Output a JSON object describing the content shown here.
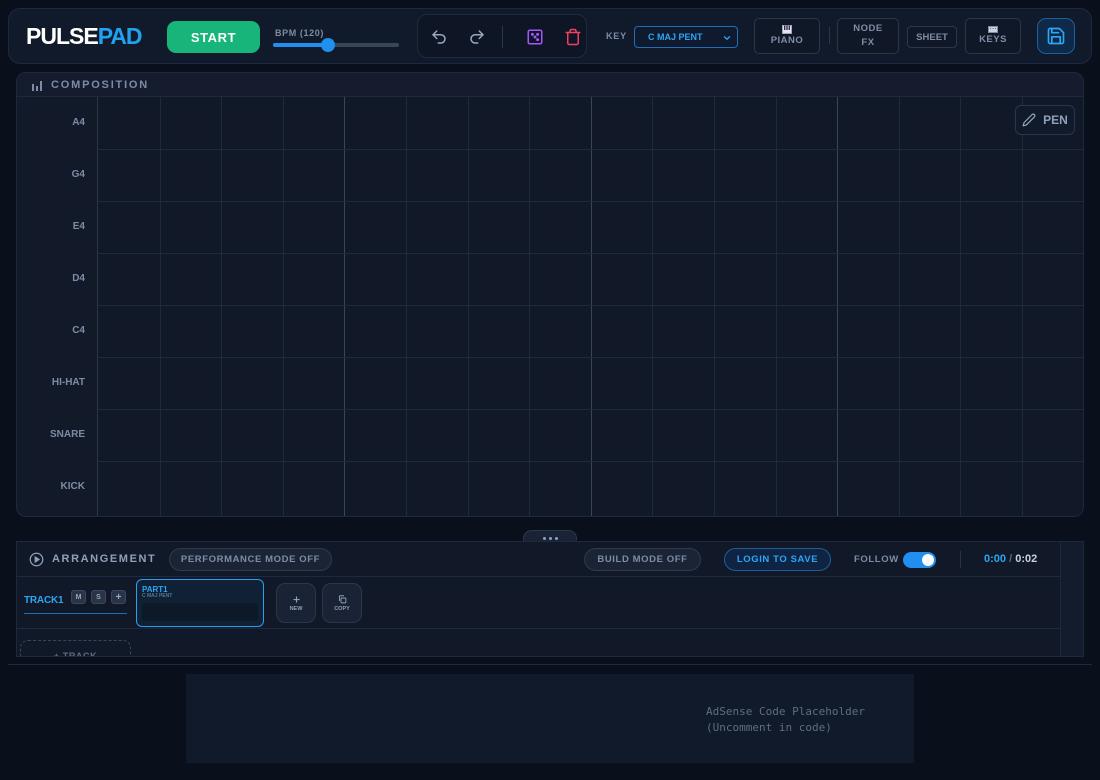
{
  "header": {
    "logo_part1": "PULSE",
    "logo_part2": "PAD",
    "start_label": "START",
    "bpm_label": "BPM (120)",
    "bpm_fraction": 0.44,
    "key_label": "KEY",
    "key_value": "C MAJ PENT",
    "piano_label": "PIANO",
    "node_label_1": "NODE",
    "node_label_2": "FX",
    "sheet_label": "SHEET",
    "keys_label": "KEYS",
    "icons": {
      "undo": "undo-icon",
      "redo": "redo-icon",
      "randomize": "dice-icon",
      "delete": "trash-icon",
      "save": "save-icon"
    },
    "colors": {
      "start": "#17b57a",
      "accent": "#1f8ff0",
      "dice": "#a855f7",
      "trash": "#f43f5e"
    }
  },
  "composition": {
    "title": "COMPOSITION",
    "pen_label": "PEN",
    "rows": [
      "A4",
      "G4",
      "E4",
      "D4",
      "C4",
      "HI-HAT",
      "SNARE",
      "KICK"
    ],
    "columns": 16,
    "bar_every": 4
  },
  "arrangement": {
    "title": "ARRANGEMENT",
    "performance_mode": "PERFORMANCE MODE OFF",
    "build_mode": "BUILD MODE OFF",
    "login_to_save": "LOGIN TO SAVE",
    "follow_label": "FOLLOW",
    "follow_on": true,
    "time_current": "0:00",
    "time_separator": "/",
    "time_total": "0:02",
    "track": {
      "name": "TRACK1",
      "mute": "M",
      "solo": "S",
      "add": "+"
    },
    "part": {
      "name": "PART1",
      "key": "C MAJ PENT"
    },
    "new_label": "NEW",
    "copy_label": "COPY",
    "add_track_label": "+ TRACK"
  },
  "ad": {
    "line1": "AdSense Code Placeholder",
    "line2": "(Uncomment in code)"
  }
}
